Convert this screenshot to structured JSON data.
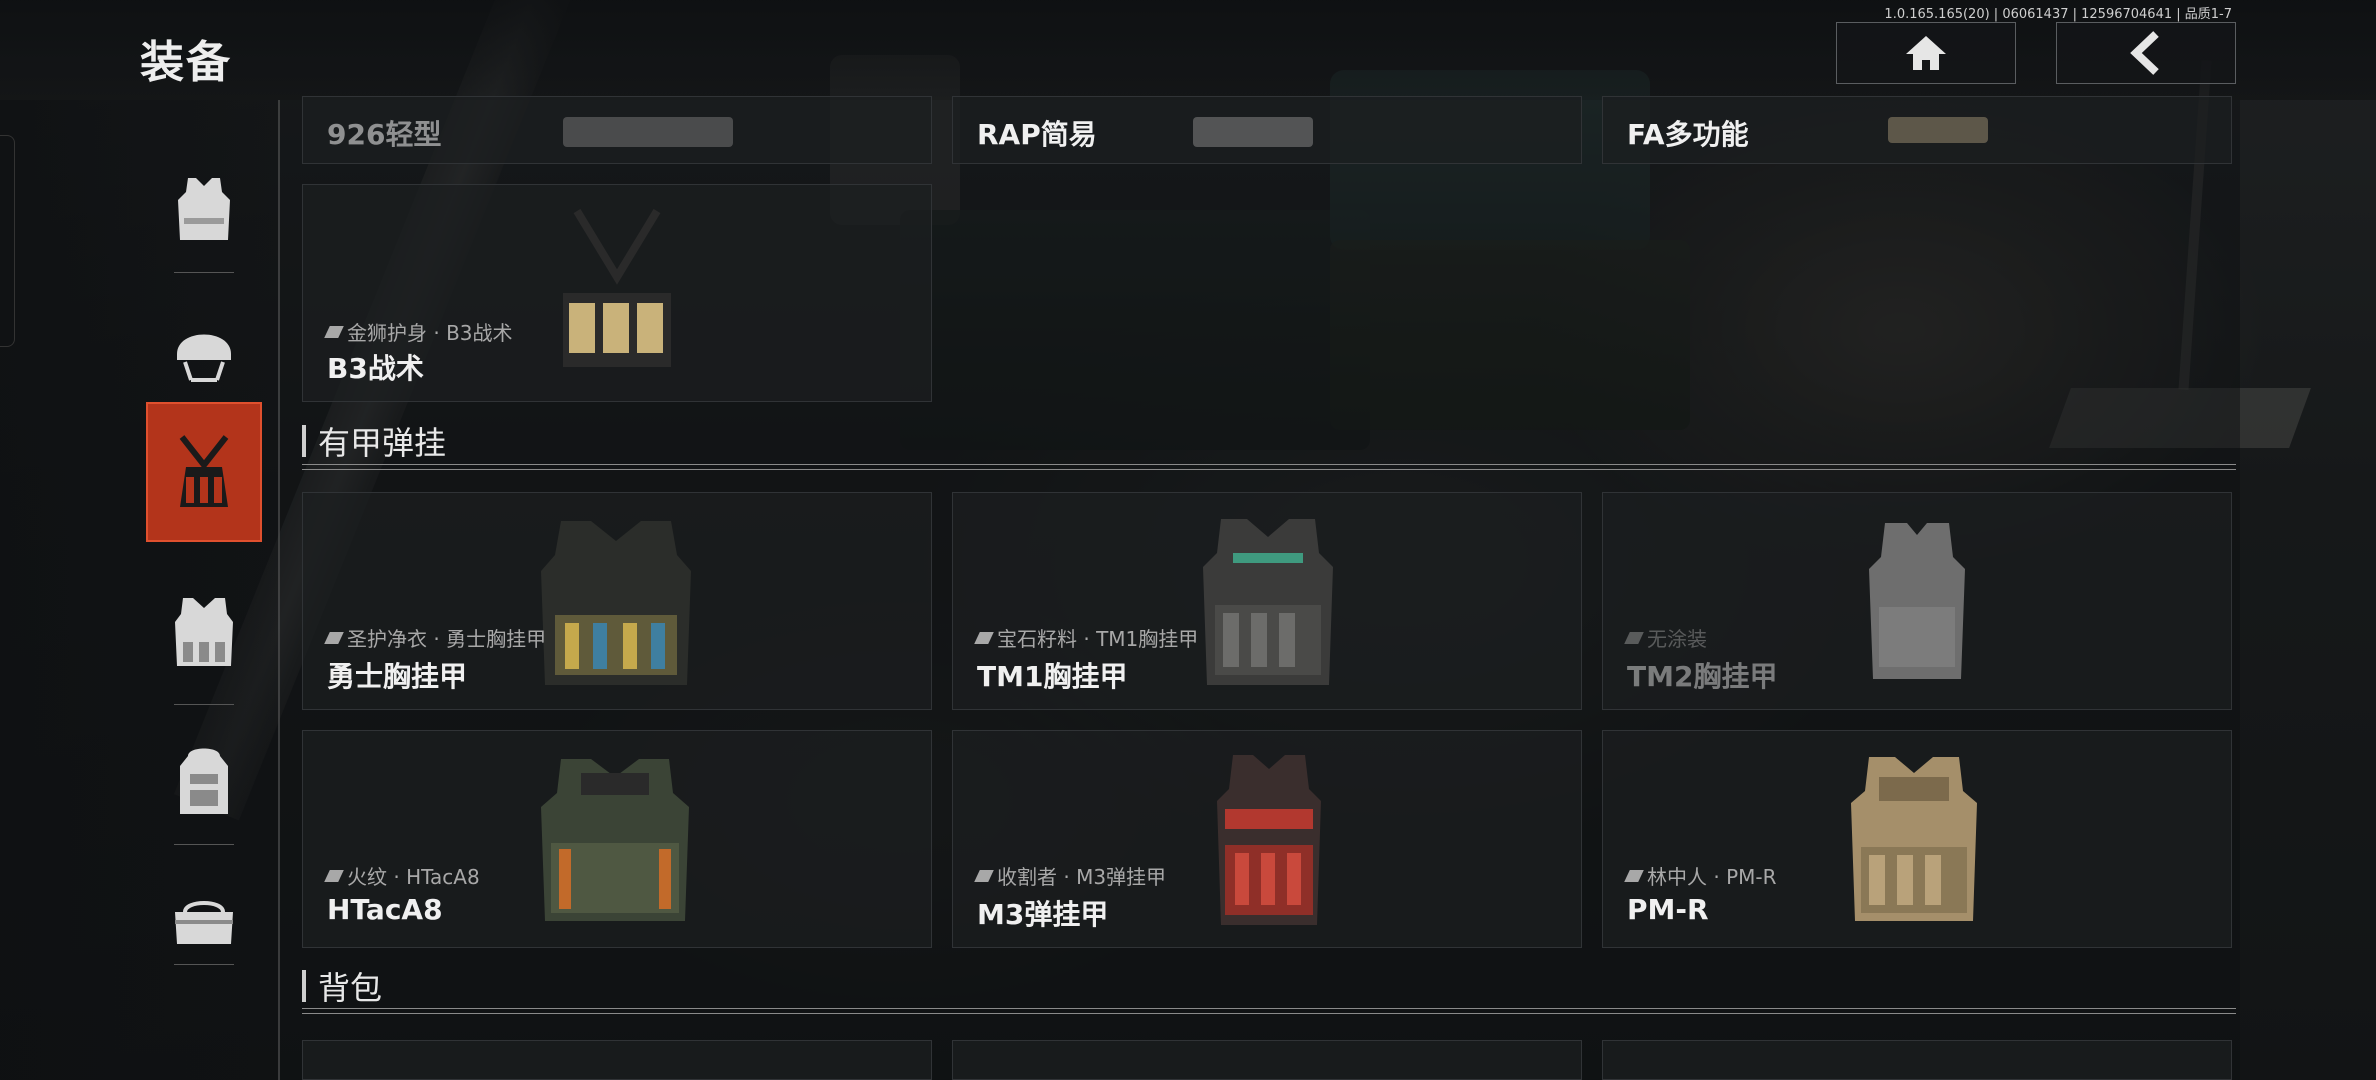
{
  "header": {
    "title": "装备",
    "version_info": "1.0.165.165(20) | 06061437 | 12596704641 | 品质1-7"
  },
  "top_buttons": {
    "home_icon": "home-icon",
    "back_icon": "back-chevron-icon"
  },
  "sidebar": {
    "categories": [
      {
        "icon": "body-armor-icon",
        "active": false
      },
      {
        "icon": "helmet-icon",
        "active": false
      },
      {
        "icon": "chest-rig-icon",
        "active": true
      },
      {
        "icon": "armored-rig-icon",
        "active": false
      },
      {
        "icon": "backpack-icon",
        "active": false
      },
      {
        "icon": "pouch-icon",
        "active": false
      }
    ]
  },
  "partial_row": {
    "items": [
      {
        "name": "926轻型"
      },
      {
        "name": "RAP简易"
      },
      {
        "name": "FA多功能"
      }
    ]
  },
  "rig_items": [
    {
      "skin": "金狮护身 · B3战术",
      "name": "B3战术"
    }
  ],
  "sections": {
    "armored_rigs": "有甲弹挂",
    "backpacks": "背包"
  },
  "armored_rig_items": [
    {
      "skin": "圣护净衣 · 勇士胸挂甲",
      "name": "勇士胸挂甲",
      "dim": false
    },
    {
      "skin": "宝石籽料 · TM1胸挂甲",
      "name": "TM1胸挂甲",
      "dim": false
    },
    {
      "skin": "无涂装",
      "name": "TM2胸挂甲",
      "dim": true
    },
    {
      "skin": "火纹 · HTacA8",
      "name": "HTacA8",
      "dim": false
    },
    {
      "skin": "收割者 · M3弹挂甲",
      "name": "M3弹挂甲",
      "dim": false
    },
    {
      "skin": "林中人 · PM-R",
      "name": "PM-R",
      "dim": false
    }
  ],
  "colors": {
    "accent": "#b3341b",
    "accent_border": "#e0502e"
  }
}
